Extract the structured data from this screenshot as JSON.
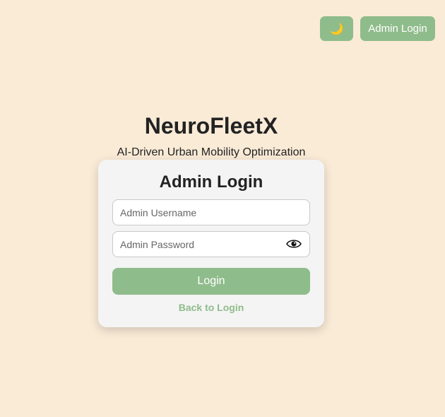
{
  "header": {
    "theme_toggle_icon": "moon-icon",
    "theme_toggle_glyph": "🌙",
    "admin_login_label": "Admin Login"
  },
  "brand": {
    "title": "NeuroFleetX",
    "subtitle": "AI-Driven Urban Mobility Optimization"
  },
  "login_card": {
    "title": "Admin Login",
    "username_placeholder": "Admin Username",
    "password_placeholder": "Admin Password",
    "password_toggle_icon": "eye-icon",
    "submit_label": "Login",
    "back_link_label": "Back to Login"
  },
  "colors": {
    "background": "#faebd7",
    "accent": "#8fbc8b",
    "card": "#f4f4f4"
  }
}
